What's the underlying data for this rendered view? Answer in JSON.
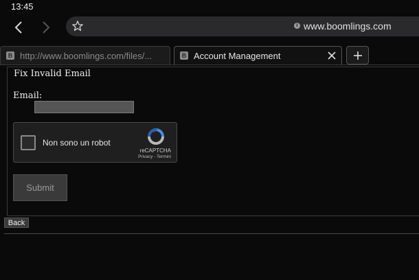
{
  "status_bar": {
    "time": "13:45"
  },
  "toolbar": {
    "url": "www.boomlings.com"
  },
  "tabs": [
    {
      "favicon": "B",
      "label": "http://www.boomlings.com/files/..."
    },
    {
      "favicon": "B",
      "label": "Account Management"
    }
  ],
  "form": {
    "legend": "Fix Invalid Email",
    "email_label": "Email:",
    "email_value": "",
    "recaptcha": {
      "label": "Non sono un robot",
      "brand": "reCAPTCHA",
      "links": "Privacy - Termini"
    },
    "submit_label": "Submit",
    "back_label": "Back"
  },
  "colors": {
    "background": "#0a0a0a",
    "recaptcha_blue": "#4a90e2"
  }
}
